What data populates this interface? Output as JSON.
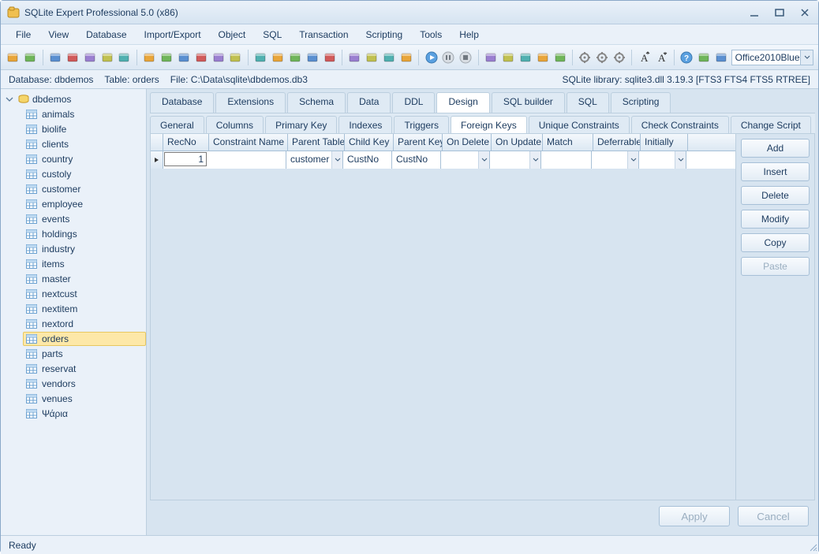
{
  "window": {
    "title": "SQLite Expert Professional 5.0 (x86)"
  },
  "menu": {
    "items": [
      "File",
      "View",
      "Database",
      "Import/Export",
      "Object",
      "SQL",
      "Transaction",
      "Scripting",
      "Tools",
      "Help"
    ]
  },
  "theme": {
    "selected": "Office2010Blue"
  },
  "infobar": {
    "database": "Database: dbdemos",
    "table": "Table: orders",
    "file": "File: C:\\Data\\sqlite\\dbdemos.db3",
    "library": "SQLite library: sqlite3.dll 3.19.3 [FTS3 FTS4 FTS5 RTREE]"
  },
  "tree": {
    "root": "dbdemos",
    "tables": [
      "animals",
      "biolife",
      "clients",
      "country",
      "custoly",
      "customer",
      "employee",
      "events",
      "holdings",
      "industry",
      "items",
      "master",
      "nextcust",
      "nextitem",
      "nextord",
      "orders",
      "parts",
      "reservat",
      "vendors",
      "venues",
      "Ψάρια"
    ],
    "selected": "orders"
  },
  "main_tabs": {
    "items": [
      "Database",
      "Extensions",
      "Schema",
      "Data",
      "DDL",
      "Design",
      "SQL builder",
      "SQL",
      "Scripting"
    ],
    "active": "Design"
  },
  "sub_tabs": {
    "items": [
      "General",
      "Columns",
      "Primary Key",
      "Indexes",
      "Triggers",
      "Foreign Keys",
      "Unique Constraints",
      "Check Constraints",
      "Change Script"
    ],
    "active": "Foreign Keys"
  },
  "grid": {
    "columns": [
      "RecNo",
      "Constraint Name",
      "Parent Table",
      "Child Key",
      "Parent Key",
      "On Delete",
      "On Update",
      "Match",
      "Deferrable",
      "Initially"
    ],
    "widths": [
      58,
      100,
      72,
      62,
      62,
      62,
      65,
      64,
      60,
      60
    ],
    "dropdown_cols": [
      2,
      5,
      6,
      8,
      9
    ],
    "row": {
      "recno": "1",
      "constraint": "",
      "parent_table": "customer",
      "child_key": "CustNo",
      "parent_key": "CustNo",
      "on_delete": "",
      "on_update": "",
      "match": "",
      "deferrable": "",
      "initially": ""
    }
  },
  "side_buttons": {
    "items": [
      "Add",
      "Insert",
      "Delete",
      "Modify",
      "Copy",
      "Paste"
    ],
    "disabled": [
      "Paste"
    ]
  },
  "bottom": {
    "apply": "Apply",
    "cancel": "Cancel"
  },
  "status": {
    "text": "Ready"
  },
  "icon_colors": [
    "#e8a53a",
    "#6fb55a",
    "#5a8fd0",
    "#d05a5a",
    "#9a7fd0",
    "#c0c050",
    "#50b0b0"
  ]
}
